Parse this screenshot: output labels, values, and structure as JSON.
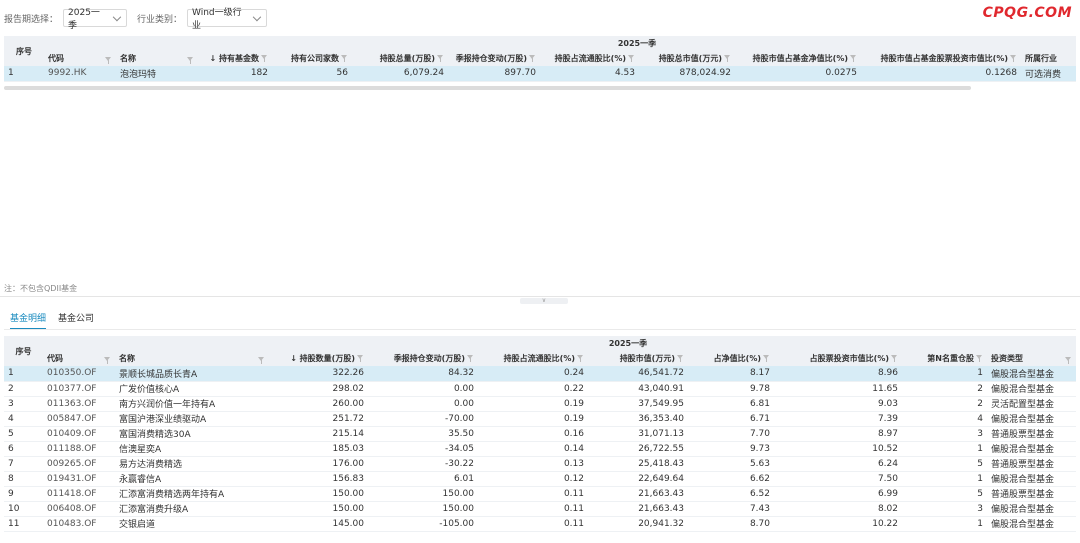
{
  "filters": {
    "period_label": "报告期选择：",
    "period_value": "2025一季",
    "industry_label": "行业类别：",
    "industry_value": "Wind一级行业"
  },
  "brand": "CPQG.COM",
  "top_table": {
    "period_header": "2025一季",
    "columns": {
      "seq": "序号",
      "code": "代码",
      "name": "名称",
      "fund_count": "↓ 持有基金数",
      "company_count": "持有公司家数",
      "total_shares": "持股总量(万股)",
      "qoq_change": "季报持仓变动(万股)",
      "float_ratio": "持股占流通股比(%)",
      "market_value": "持股总市值(万元)",
      "nav_ratio": "持股市值占基金净值比(%)",
      "stock_inv_ratio": "持股市值占基金股票投资市值比(%)",
      "industry": "所属行业"
    },
    "rows": [
      {
        "seq": "1",
        "code": "9992.HK",
        "name": "泡泡玛特",
        "fund_count": "182",
        "company_count": "56",
        "total_shares": "6,079.24",
        "qoq_change": "897.70",
        "float_ratio": "4.53",
        "market_value": "878,024.92",
        "nav_ratio": "0.0275",
        "stock_inv_ratio": "0.1268",
        "industry": "可选消费"
      }
    ]
  },
  "note": "注：不包含QDII基金",
  "tabs": {
    "detail": "基金明细",
    "company": "基金公司"
  },
  "bottom_table": {
    "period_header": "2025一季",
    "columns": {
      "seq": "序号",
      "code": "代码",
      "name": "名称",
      "shares": "↓ 持股数量(万股)",
      "qoq_change": "季报持仓变动(万股)",
      "float_ratio": "持股占流通股比(%)",
      "market_value": "持股市值(万元)",
      "nav_ratio": "占净值比(%)",
      "stock_inv_ratio": "占股票投资市值比(%)",
      "rank": "第N名重仓股",
      "inv_type": "投资类型"
    },
    "rows": [
      {
        "seq": "1",
        "code": "010350.OF",
        "name": "景顺长城品质长青A",
        "shares": "322.26",
        "qoq_change": "84.32",
        "float_ratio": "0.24",
        "market_value": "46,541.72",
        "nav_ratio": "8.17",
        "stock_inv_ratio": "8.96",
        "rank": "1",
        "inv_type": "偏股混合型基金"
      },
      {
        "seq": "2",
        "code": "010377.OF",
        "name": "广发价值核心A",
        "shares": "298.02",
        "qoq_change": "0.00",
        "float_ratio": "0.22",
        "market_value": "43,040.91",
        "nav_ratio": "9.78",
        "stock_inv_ratio": "11.65",
        "rank": "2",
        "inv_type": "偏股混合型基金"
      },
      {
        "seq": "3",
        "code": "011363.OF",
        "name": "南方兴润价值一年持有A",
        "shares": "260.00",
        "qoq_change": "0.00",
        "float_ratio": "0.19",
        "market_value": "37,549.95",
        "nav_ratio": "6.81",
        "stock_inv_ratio": "9.03",
        "rank": "2",
        "inv_type": "灵活配置型基金"
      },
      {
        "seq": "4",
        "code": "005847.OF",
        "name": "富国沪港深业绩驱动A",
        "shares": "251.72",
        "qoq_change": "-70.00",
        "float_ratio": "0.19",
        "market_value": "36,353.40",
        "nav_ratio": "6.71",
        "stock_inv_ratio": "7.39",
        "rank": "4",
        "inv_type": "偏股混合型基金"
      },
      {
        "seq": "5",
        "code": "010409.OF",
        "name": "富国消费精选30A",
        "shares": "215.14",
        "qoq_change": "35.50",
        "float_ratio": "0.16",
        "market_value": "31,071.13",
        "nav_ratio": "7.70",
        "stock_inv_ratio": "8.97",
        "rank": "3",
        "inv_type": "普通股票型基金"
      },
      {
        "seq": "6",
        "code": "011188.OF",
        "name": "信澳星奕A",
        "shares": "185.03",
        "qoq_change": "-34.05",
        "float_ratio": "0.14",
        "market_value": "26,722.55",
        "nav_ratio": "9.73",
        "stock_inv_ratio": "10.52",
        "rank": "1",
        "inv_type": "偏股混合型基金"
      },
      {
        "seq": "7",
        "code": "009265.OF",
        "name": "易方达消费精选",
        "shares": "176.00",
        "qoq_change": "-30.22",
        "float_ratio": "0.13",
        "market_value": "25,418.43",
        "nav_ratio": "5.63",
        "stock_inv_ratio": "6.24",
        "rank": "5",
        "inv_type": "普通股票型基金"
      },
      {
        "seq": "8",
        "code": "019431.OF",
        "name": "永赢睿信A",
        "shares": "156.83",
        "qoq_change": "6.01",
        "float_ratio": "0.12",
        "market_value": "22,649.64",
        "nav_ratio": "6.62",
        "stock_inv_ratio": "7.50",
        "rank": "1",
        "inv_type": "偏股混合型基金"
      },
      {
        "seq": "9",
        "code": "011418.OF",
        "name": "汇添富消费精选两年持有A",
        "shares": "150.00",
        "qoq_change": "150.00",
        "float_ratio": "0.11",
        "market_value": "21,663.43",
        "nav_ratio": "6.52",
        "stock_inv_ratio": "6.99",
        "rank": "5",
        "inv_type": "普通股票型基金"
      },
      {
        "seq": "10",
        "code": "006408.OF",
        "name": "汇添富消费升级A",
        "shares": "150.00",
        "qoq_change": "150.00",
        "float_ratio": "0.11",
        "market_value": "21,663.43",
        "nav_ratio": "7.43",
        "stock_inv_ratio": "8.02",
        "rank": "3",
        "inv_type": "偏股混合型基金"
      },
      {
        "seq": "11",
        "code": "010483.OF",
        "name": "交银启道",
        "shares": "145.00",
        "qoq_change": "-105.00",
        "float_ratio": "0.11",
        "market_value": "20,941.32",
        "nav_ratio": "8.70",
        "stock_inv_ratio": "10.22",
        "rank": "1",
        "inv_type": "偏股混合型基金"
      }
    ]
  }
}
